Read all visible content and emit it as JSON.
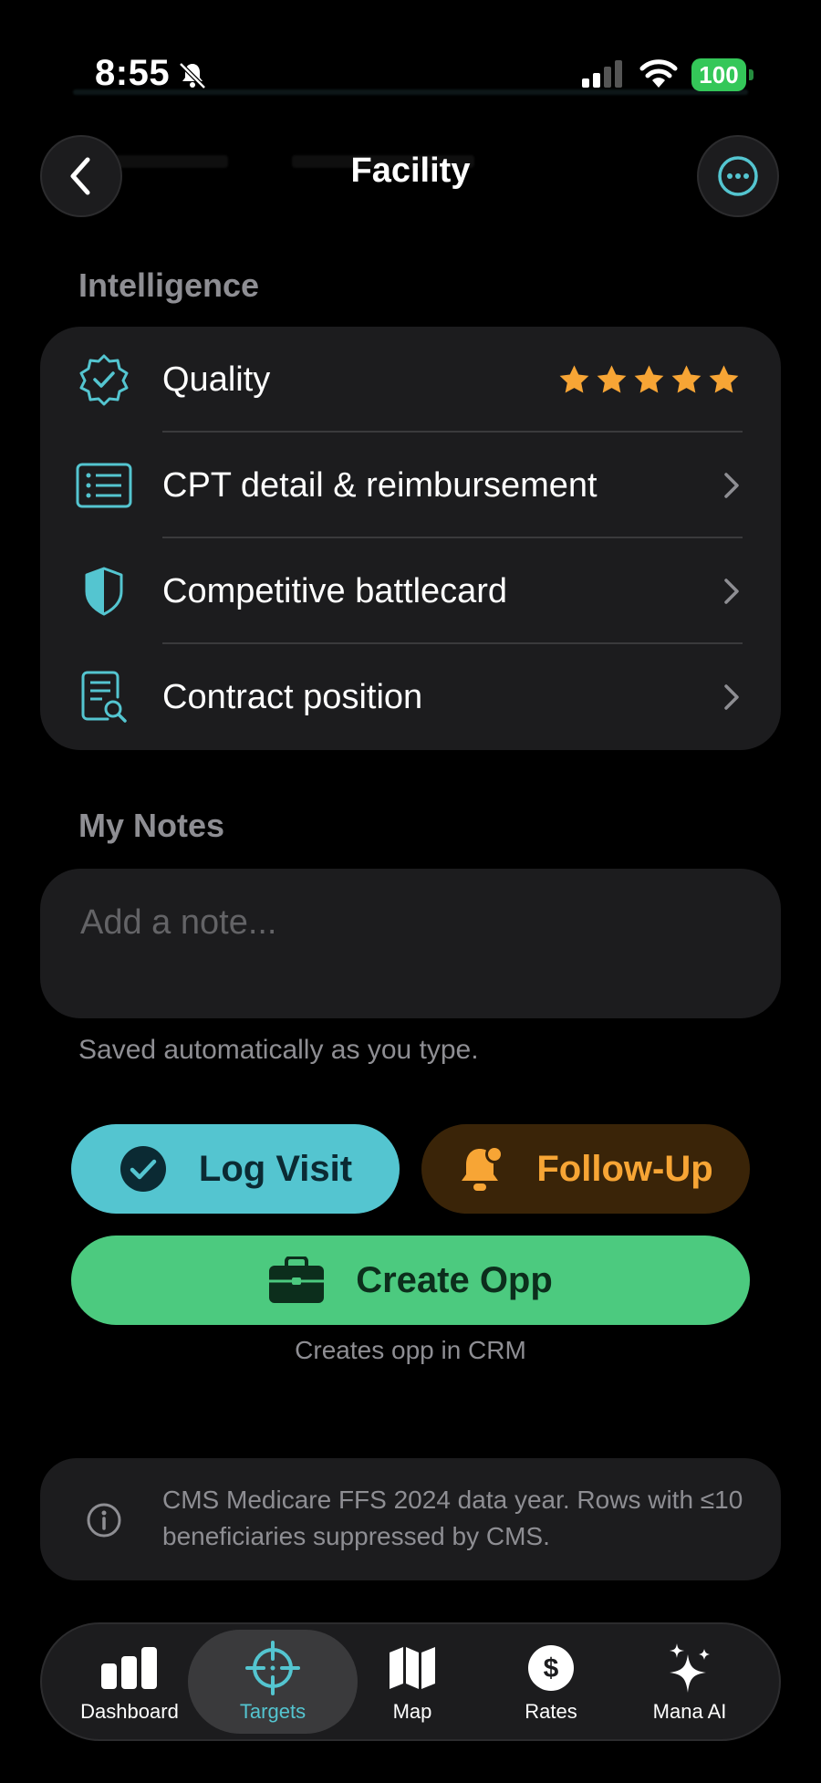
{
  "status_bar": {
    "time": "8:55",
    "battery": "100"
  },
  "nav": {
    "title": "Facility",
    "back_icon": "chevron-left-icon",
    "more_icon": "ellipsis-circle-icon"
  },
  "intelligence": {
    "header": "Intelligence",
    "rows": [
      {
        "label": "Quality",
        "icon": "verified-badge-icon",
        "stars": 5
      },
      {
        "label": "CPT detail & reimbursement",
        "icon": "list-icon"
      },
      {
        "label": "Competitive battlecard",
        "icon": "shield-icon"
      },
      {
        "label": "Contract position",
        "icon": "document-search-icon"
      }
    ]
  },
  "notes": {
    "header": "My Notes",
    "placeholder": "Add a note...",
    "value": "",
    "hint": "Saved automatically as you type."
  },
  "actions": {
    "log_visit": "Log Visit",
    "follow_up": "Follow-Up",
    "create_opp": "Create Opp",
    "create_opp_hint": "Creates opp in CRM"
  },
  "info": {
    "text": "CMS Medicare FFS 2024 data year. Rows with ≤10 beneficiaries suppressed by CMS."
  },
  "tabs": [
    {
      "label": "Dashboard",
      "icon": "bar-chart-icon"
    },
    {
      "label": "Targets",
      "icon": "crosshair-icon",
      "active": true
    },
    {
      "label": "Map",
      "icon": "map-icon"
    },
    {
      "label": "Rates",
      "icon": "dollar-circle-icon"
    },
    {
      "label": "Mana AI",
      "icon": "sparkles-icon"
    }
  ],
  "colors": {
    "accent_teal": "#54c5d0",
    "accent_orange": "#f7a535",
    "accent_green": "#4cca7f",
    "star": "#f7a535",
    "card_bg": "#1c1c1e"
  }
}
